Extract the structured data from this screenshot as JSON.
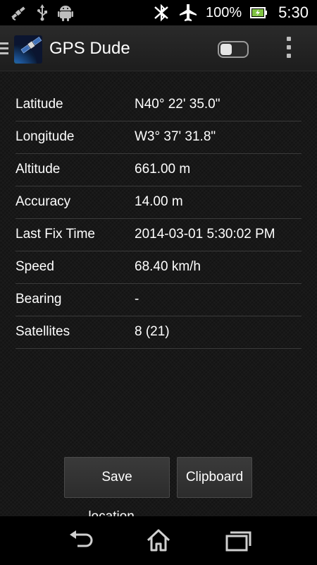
{
  "status_bar": {
    "battery_text": "100%",
    "time": "5:30",
    "icons": [
      "satellite-icon",
      "usb-icon",
      "android-icon",
      "bluetooth-icon",
      "airplane-mode-icon",
      "battery-icon"
    ]
  },
  "action_bar": {
    "title": "GPS Dude",
    "toggle_state": "off",
    "icons": [
      "drawer-icon",
      "app-icon",
      "toggle-switch",
      "overflow-menu-icon"
    ]
  },
  "gps_info": [
    {
      "label": "Latitude",
      "value": "N40° 22' 35.0\""
    },
    {
      "label": "Longitude",
      "value": "W3° 37' 31.8\""
    },
    {
      "label": "Altitude",
      "value": "661.00 m"
    },
    {
      "label": "Accuracy",
      "value": "14.00 m"
    },
    {
      "label": "Last Fix Time",
      "value": "2014-03-01 5:30:02 PM"
    },
    {
      "label": "Speed",
      "value": "68.40 km/h"
    },
    {
      "label": "Bearing",
      "value": "-"
    },
    {
      "label": "Satellites",
      "value": "8 (21)"
    }
  ],
  "buttons": {
    "save_label": "Save location...",
    "clipboard_label": "Clipboard"
  },
  "nav_bar": {
    "icons": [
      "back-icon",
      "home-icon",
      "recent-apps-icon"
    ]
  },
  "colors": {
    "background": "#151515",
    "status_bar": "#000000",
    "divider": "#3a3a3a",
    "battery_green": "#7fc241"
  }
}
